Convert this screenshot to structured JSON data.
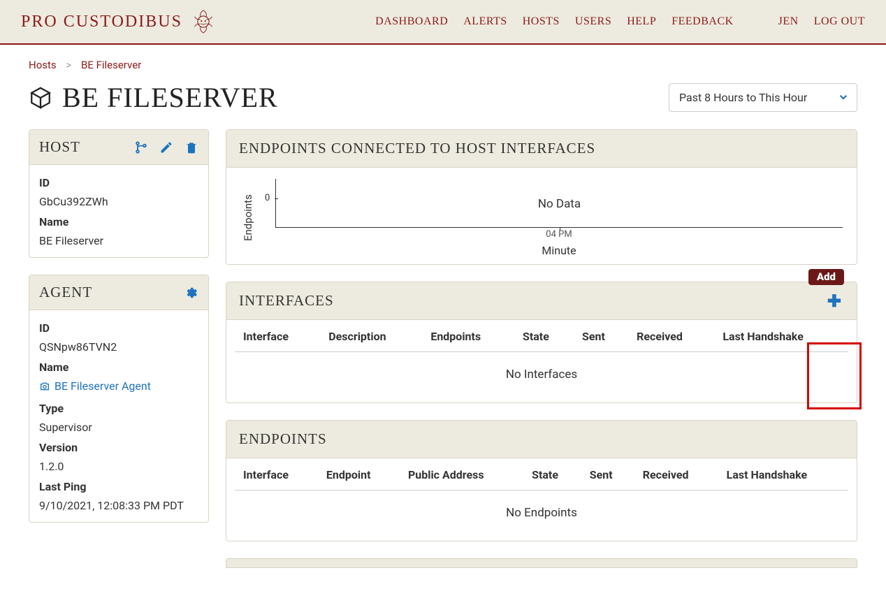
{
  "brand": "PRO CUSTODIBUS",
  "nav": {
    "dashboard": "DASHBOARD",
    "alerts": "ALERTS",
    "hosts": "HOSTS",
    "users": "USERS",
    "help": "HELP",
    "feedback": "FEEDBACK",
    "username": "JEN",
    "logout": "LOG OUT"
  },
  "breadcrumb": {
    "root": "Hosts",
    "current": "BE Fileserver"
  },
  "page_title": "BE FILESERVER",
  "range_selector": "Past 8 Hours to This Hour",
  "host_card": {
    "title": "HOST",
    "id_label": "ID",
    "id_value": "GbCu392ZWh",
    "name_label": "Name",
    "name_value": "BE Fileserver"
  },
  "agent_card": {
    "title": "AGENT",
    "id_label": "ID",
    "id_value": "QSNpw86TVN2",
    "name_label": "Name",
    "name_value": "BE Fileserver Agent",
    "type_label": "Type",
    "type_value": "Supervisor",
    "version_label": "Version",
    "version_value": "1.2.0",
    "lastping_label": "Last Ping",
    "lastping_value": "9/10/2021, 12:08:33 PM PDT"
  },
  "endpoints_panel": {
    "title": "ENDPOINTS CONNECTED TO HOST INTERFACES"
  },
  "interfaces_panel": {
    "title": "INTERFACES",
    "add_tooltip": "Add",
    "columns": [
      "Interface",
      "Description",
      "Endpoints",
      "State",
      "Sent",
      "Received",
      "Last Handshake"
    ],
    "empty": "No Interfaces"
  },
  "endpoints_table_panel": {
    "title": "ENDPOINTS",
    "columns": [
      "Interface",
      "Endpoint",
      "Public Address",
      "State",
      "Sent",
      "Received",
      "Last Handshake"
    ],
    "empty": "No Endpoints"
  },
  "chart_data": {
    "type": "line",
    "title": "",
    "ylabel": "Endpoints",
    "xlabel": "Minute",
    "x_ticks": [
      "04 PM"
    ],
    "ylim": [
      0,
      0
    ],
    "y_ticks": [
      0
    ],
    "series": [],
    "no_data_text": "No Data"
  }
}
